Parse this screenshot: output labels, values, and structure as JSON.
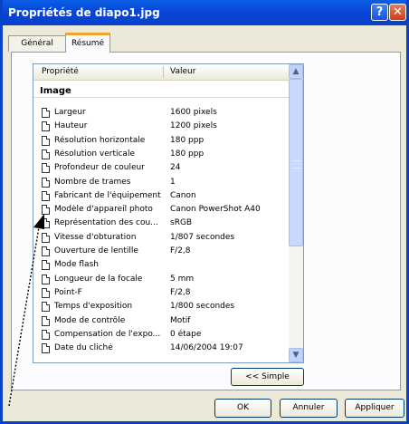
{
  "window": {
    "title": "Propriétés de diapo1.jpg",
    "help_glyph": "?",
    "close_glyph": "✕"
  },
  "tabs": [
    {
      "label": "Général"
    },
    {
      "label": "Résumé"
    }
  ],
  "list": {
    "headers": {
      "property": "Propriété",
      "value": "Valeur"
    },
    "group": "Image",
    "rows": [
      {
        "name": "Largeur",
        "value": "1600 pixels"
      },
      {
        "name": "Hauteur",
        "value": "1200 pixels"
      },
      {
        "name": "Résolution horizontale",
        "value": "180 ppp"
      },
      {
        "name": "Résolution verticale",
        "value": "180 ppp"
      },
      {
        "name": "Profondeur de couleur",
        "value": "24"
      },
      {
        "name": "Nombre de trames",
        "value": "1"
      },
      {
        "name": "Fabricant de l'équipement",
        "value": "Canon"
      },
      {
        "name": "Modèle d'appareil photo",
        "value": "Canon PowerShot A40"
      },
      {
        "name": "Représentation des cou...",
        "value": "sRGB"
      },
      {
        "name": "Vitesse d'obturation",
        "value": "1/807 secondes"
      },
      {
        "name": "Ouverture de lentille",
        "value": "F/2,8"
      },
      {
        "name": "Mode flash",
        "value": ""
      },
      {
        "name": "Longueur de la focale",
        "value": "5 mm"
      },
      {
        "name": "Point-F",
        "value": "F/2,8"
      },
      {
        "name": "Temps d'exposition",
        "value": "1/800 secondes"
      },
      {
        "name": "Mode de contrôle",
        "value": "Motif"
      },
      {
        "name": "Compensation de l'expo...",
        "value": "0 étape"
      },
      {
        "name": "Date du cliché",
        "value": "14/06/2004 19:07"
      }
    ],
    "scroll_up_glyph": "▲",
    "scroll_down_glyph": "▼"
  },
  "buttons": {
    "simple": "<< Simple",
    "ok": "OK",
    "annuler": "Annuler",
    "appliquer": "Appliquer"
  },
  "colors": {
    "titlebar": "#0842c9",
    "tab_accent": "#f2a331",
    "dialog_bg": "#ece9d8"
  }
}
